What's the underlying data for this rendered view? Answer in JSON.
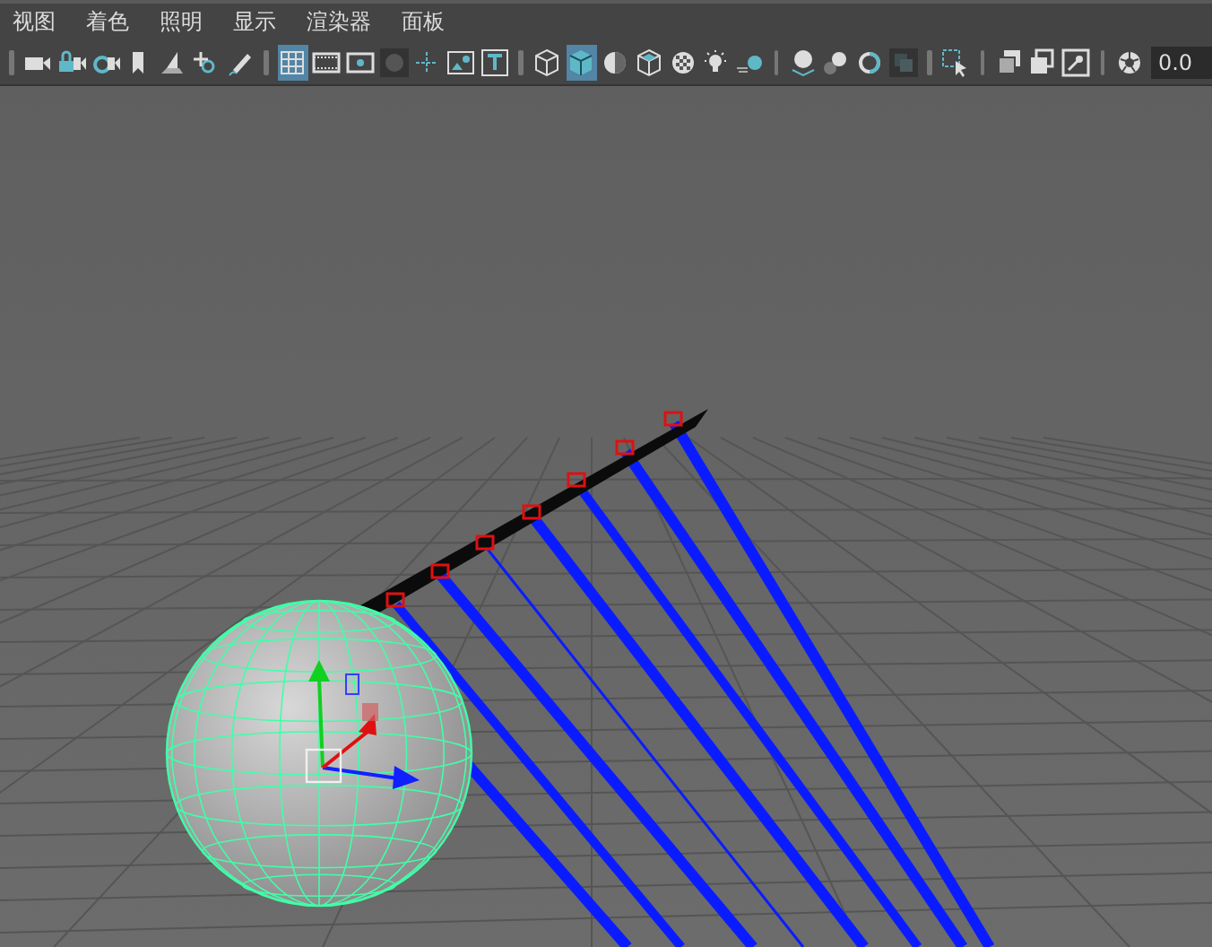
{
  "menu": [
    "视图",
    "着色",
    "照明",
    "显示",
    "渲染器",
    "面板"
  ],
  "toolbar": {
    "groups": [
      {
        "tools": [
          {
            "selected": false
          },
          {
            "selected": false
          },
          {
            "selected": false
          },
          {
            "selected": false
          },
          {
            "selected": false
          },
          {
            "selected": false
          },
          {
            "selected": false
          }
        ]
      },
      {
        "tools": [
          {
            "selected": true
          },
          {
            "selected": false
          },
          {
            "selected": false
          },
          {
            "selected": false
          },
          {
            "selected": false
          },
          {
            "selected": false
          },
          {
            "selected": false
          }
        ]
      },
      {
        "tools": [
          {
            "selected": false
          },
          {
            "selected": true
          },
          {
            "selected": false
          },
          {
            "selected": false
          },
          {
            "selected": false
          },
          {
            "selected": false
          },
          {
            "selected": false
          }
        ]
      },
      {
        "tools": [
          {
            "selected": false
          },
          {
            "selected": false
          },
          {
            "selected": false
          },
          {
            "selected": false
          }
        ]
      },
      {
        "tools": [
          {
            "selected": false
          }
        ]
      },
      {
        "tools": [
          {
            "selected": false
          },
          {
            "selected": false
          },
          {
            "selected": false
          }
        ]
      },
      {
        "tools": [
          {
            "selected": false
          }
        ]
      }
    ],
    "exposure_value": "0.0"
  }
}
